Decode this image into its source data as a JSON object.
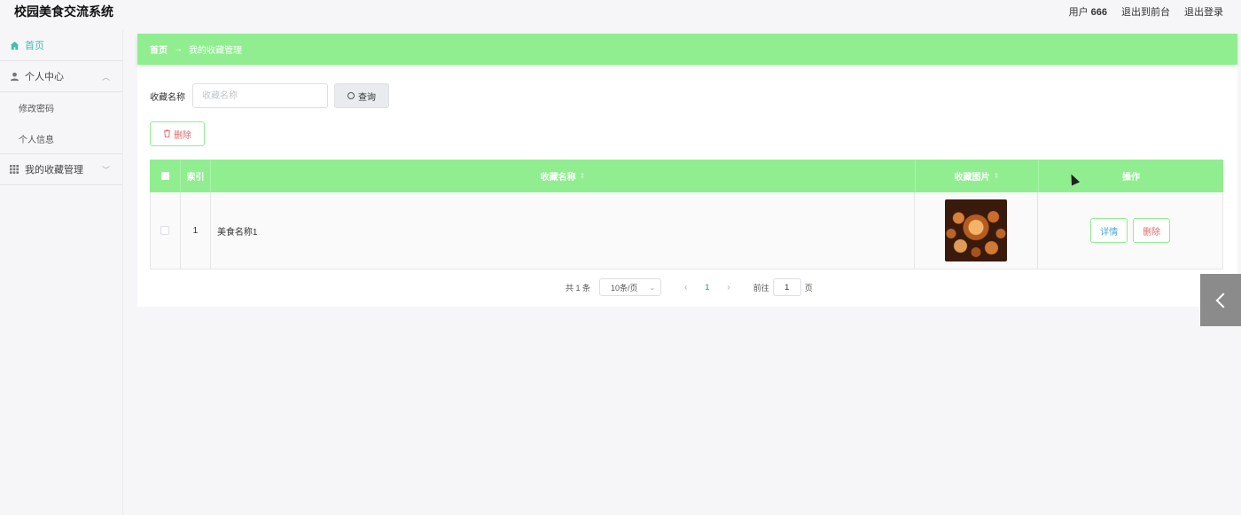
{
  "header": {
    "app_title": "校园美食交流系统",
    "user_label": "用户",
    "user_name": "666",
    "to_front": "退出到前台",
    "logout": "退出登录"
  },
  "sidebar": {
    "home": "首页",
    "personal_center": "个人中心",
    "change_password": "修改密码",
    "personal_info": "个人信息",
    "favorites_mgmt": "我的收藏管理"
  },
  "breadcrumb": {
    "home": "首页",
    "arrow": "→",
    "current": "我的收藏管理"
  },
  "search": {
    "label": "收藏名称",
    "placeholder": "收藏名称",
    "button": "查询"
  },
  "actions": {
    "delete": "删除"
  },
  "table": {
    "columns": {
      "index": "索引",
      "name": "收藏名称",
      "image": "收藏图片",
      "operation": "操作"
    },
    "rows": [
      {
        "index": "1",
        "name": "美食名称1",
        "detail": "详情",
        "delete": "删除"
      }
    ]
  },
  "pagination": {
    "total": "共 1 条",
    "page_size": "10条/页",
    "current_page": "1",
    "goto_label": "前往",
    "goto_value": "1",
    "goto_suffix": "页"
  },
  "colors": {
    "accent": "#90ee90",
    "active_nav": "#3ec1a8",
    "danger": "#e06a6a"
  }
}
